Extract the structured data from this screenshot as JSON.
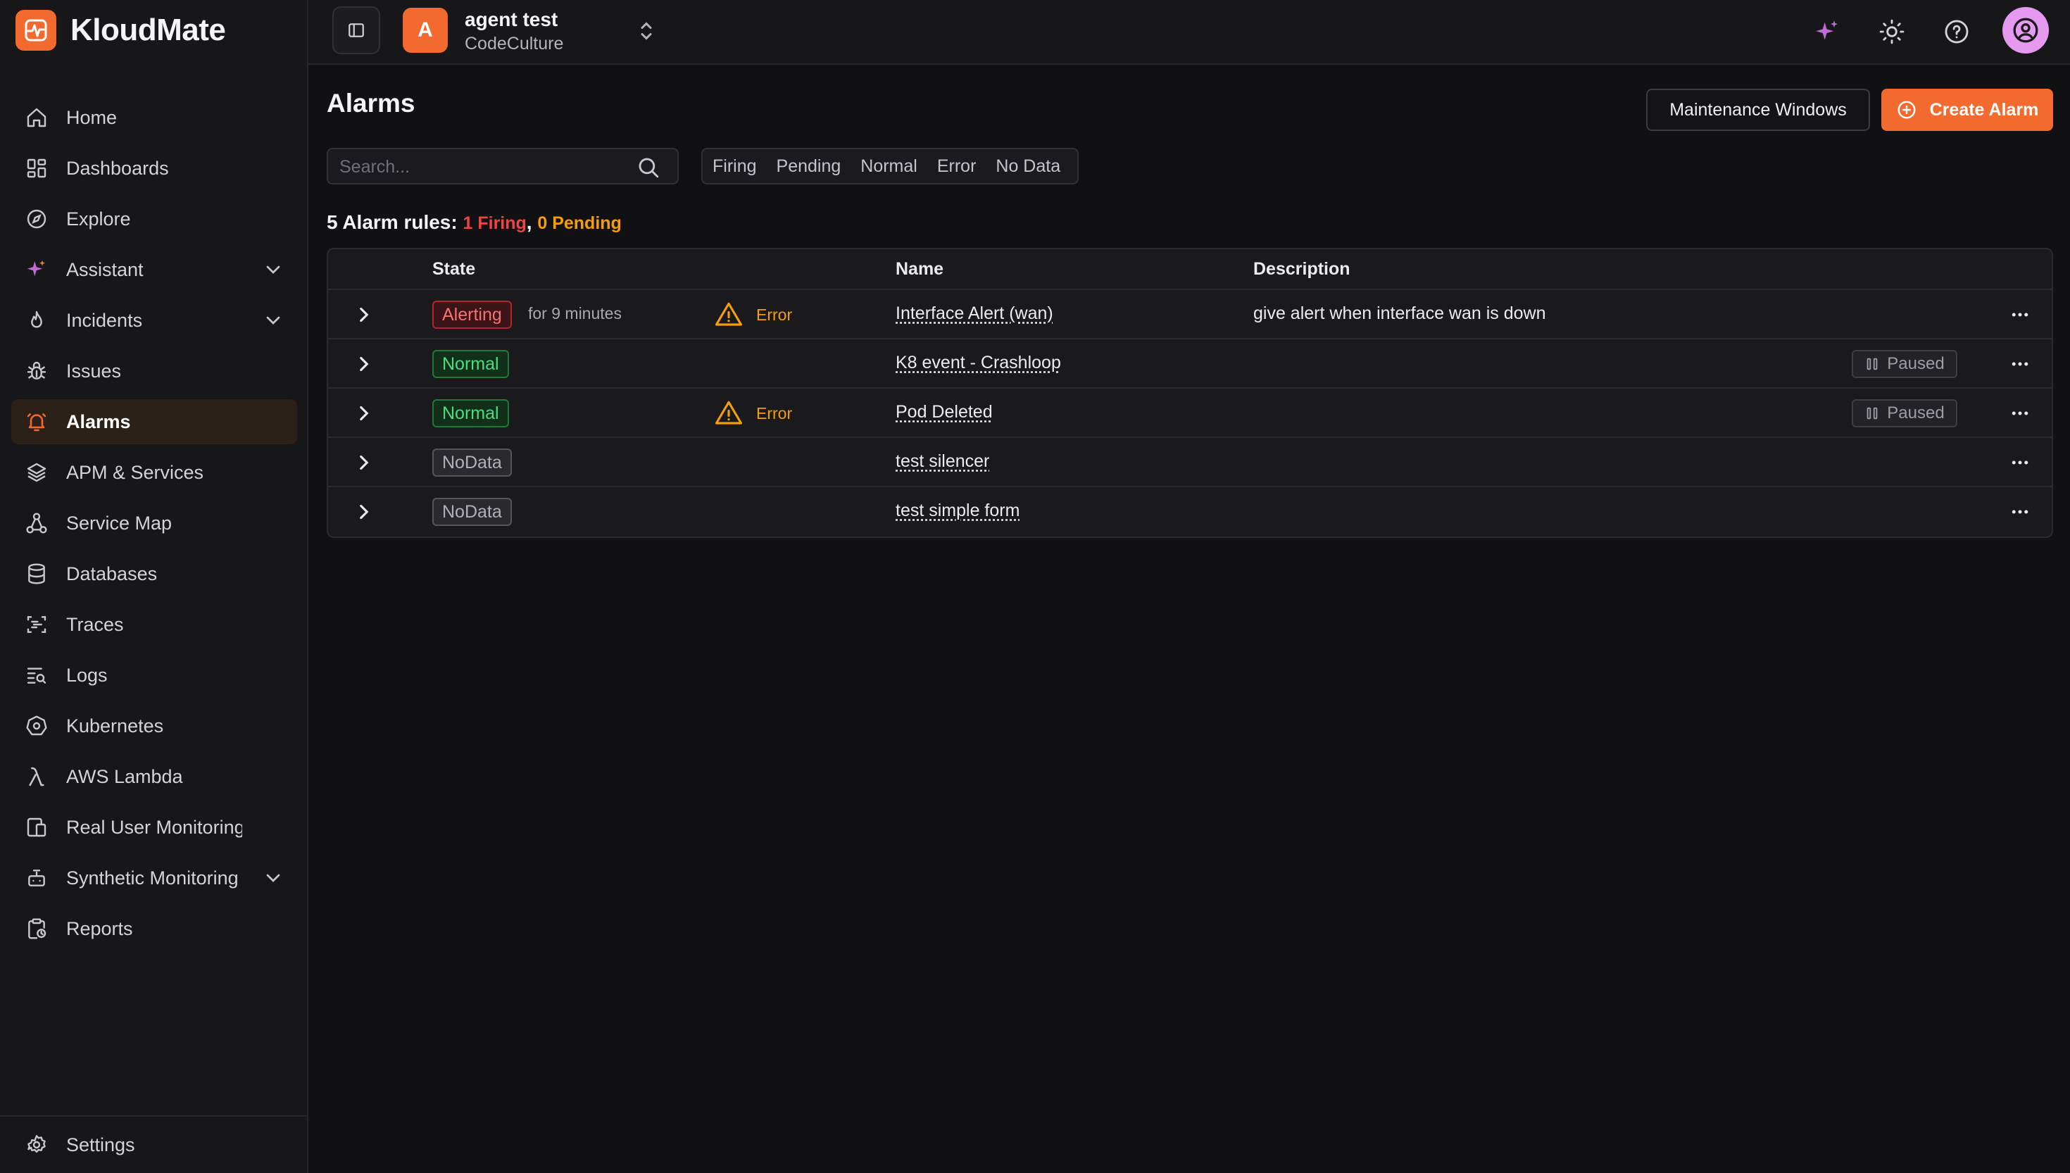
{
  "app": {
    "name": "KloudMate"
  },
  "org": {
    "avatar_letter": "A",
    "name": "agent test",
    "subtitle": "CodeCulture"
  },
  "colors": {
    "accent": "#f26a2e",
    "firing": "#ef4444",
    "pending": "#f59e0b",
    "normal": "#4ade80"
  },
  "sidebar": {
    "items": [
      {
        "label": "Home",
        "icon": "home-icon"
      },
      {
        "label": "Dashboards",
        "icon": "dashboards-icon"
      },
      {
        "label": "Explore",
        "icon": "compass-icon"
      },
      {
        "label": "Assistant",
        "icon": "sparkle-icon",
        "expandable": true
      },
      {
        "label": "Incidents",
        "icon": "flame-icon",
        "expandable": true
      },
      {
        "label": "Issues",
        "icon": "bug-icon"
      },
      {
        "label": "Alarms",
        "icon": "bell-icon",
        "active": true
      },
      {
        "label": "APM & Services",
        "icon": "layers-icon"
      },
      {
        "label": "Service Map",
        "icon": "service-map-icon"
      },
      {
        "label": "Databases",
        "icon": "database-icon"
      },
      {
        "label": "Traces",
        "icon": "traces-icon"
      },
      {
        "label": "Logs",
        "icon": "logs-icon"
      },
      {
        "label": "Kubernetes",
        "icon": "kubernetes-icon"
      },
      {
        "label": "AWS Lambda",
        "icon": "lambda-icon"
      },
      {
        "label": "Real User Monitoring",
        "icon": "devices-icon"
      },
      {
        "label": "Synthetic Monitoring",
        "icon": "robot-icon",
        "expandable": true
      },
      {
        "label": "Reports",
        "icon": "reports-icon"
      }
    ],
    "settings_label": "Settings"
  },
  "page": {
    "title": "Alarms",
    "maintenance_button": "Maintenance Windows",
    "create_button": "Create Alarm",
    "search_placeholder": "Search...",
    "filters": [
      "Firing",
      "Pending",
      "Normal",
      "Error",
      "No Data"
    ],
    "summary": {
      "prefix": "5 Alarm rules:",
      "firing": "1 Firing",
      "separator": ",",
      "pending": "0 Pending"
    }
  },
  "table": {
    "columns": {
      "state": "State",
      "name": "Name",
      "description": "Description"
    },
    "rows": [
      {
        "state": "Alerting",
        "state_kind": "alerting",
        "duration": "for 9 minutes",
        "health": "Error",
        "name": "Interface Alert (wan)",
        "description": "give alert when interface wan is down",
        "paused": ""
      },
      {
        "state": "Normal",
        "state_kind": "normal",
        "duration": "",
        "health": "",
        "name": "K8 event - Crashloop",
        "description": "",
        "paused": "Paused"
      },
      {
        "state": "Normal",
        "state_kind": "normal",
        "duration": "",
        "health": "Error",
        "name": "Pod Deleted",
        "description": "",
        "paused": "Paused"
      },
      {
        "state": "NoData",
        "state_kind": "nodata",
        "duration": "",
        "health": "",
        "name": "test silencer",
        "description": "",
        "paused": ""
      },
      {
        "state": "NoData",
        "state_kind": "nodata",
        "duration": "",
        "health": "",
        "name": "test simple form",
        "description": "",
        "paused": ""
      }
    ]
  }
}
